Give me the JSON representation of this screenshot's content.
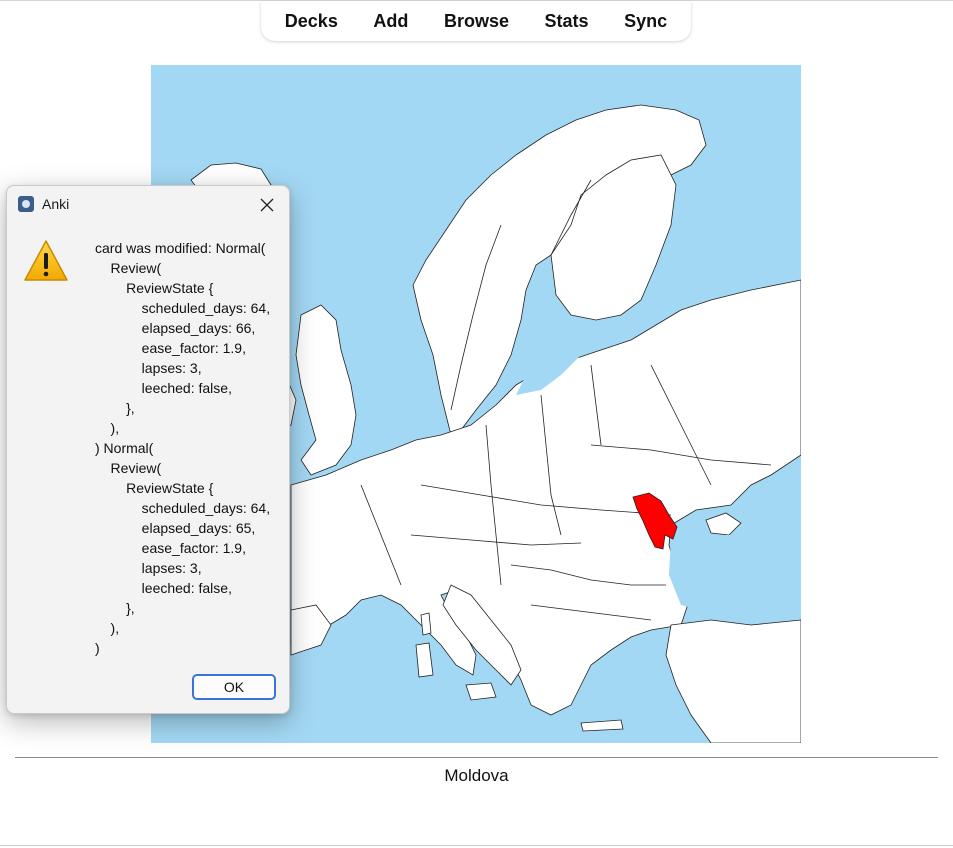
{
  "toolbar": {
    "items": [
      {
        "label": "Decks"
      },
      {
        "label": "Add"
      },
      {
        "label": "Browse"
      },
      {
        "label": "Stats"
      },
      {
        "label": "Sync"
      }
    ]
  },
  "card": {
    "answer": "Moldova",
    "map": {
      "sea_color": "#a3d8f4",
      "land_color": "#ffffff",
      "border_color": "#222222",
      "highlight_color": "#ff0000",
      "highlighted_country": "Moldova"
    }
  },
  "dialog": {
    "title": "Anki",
    "icon": "warning-icon",
    "message": "card was modified: Normal(\n    Review(\n        ReviewState {\n            scheduled_days: 64,\n            elapsed_days: 66,\n            ease_factor: 1.9,\n            lapses: 3,\n            leeched: false,\n        },\n    ),\n) Normal(\n    Review(\n        ReviewState {\n            scheduled_days: 64,\n            elapsed_days: 65,\n            ease_factor: 1.9,\n            lapses: 3,\n            leeched: false,\n        },\n    ),\n)",
    "ok_label": "OK"
  }
}
